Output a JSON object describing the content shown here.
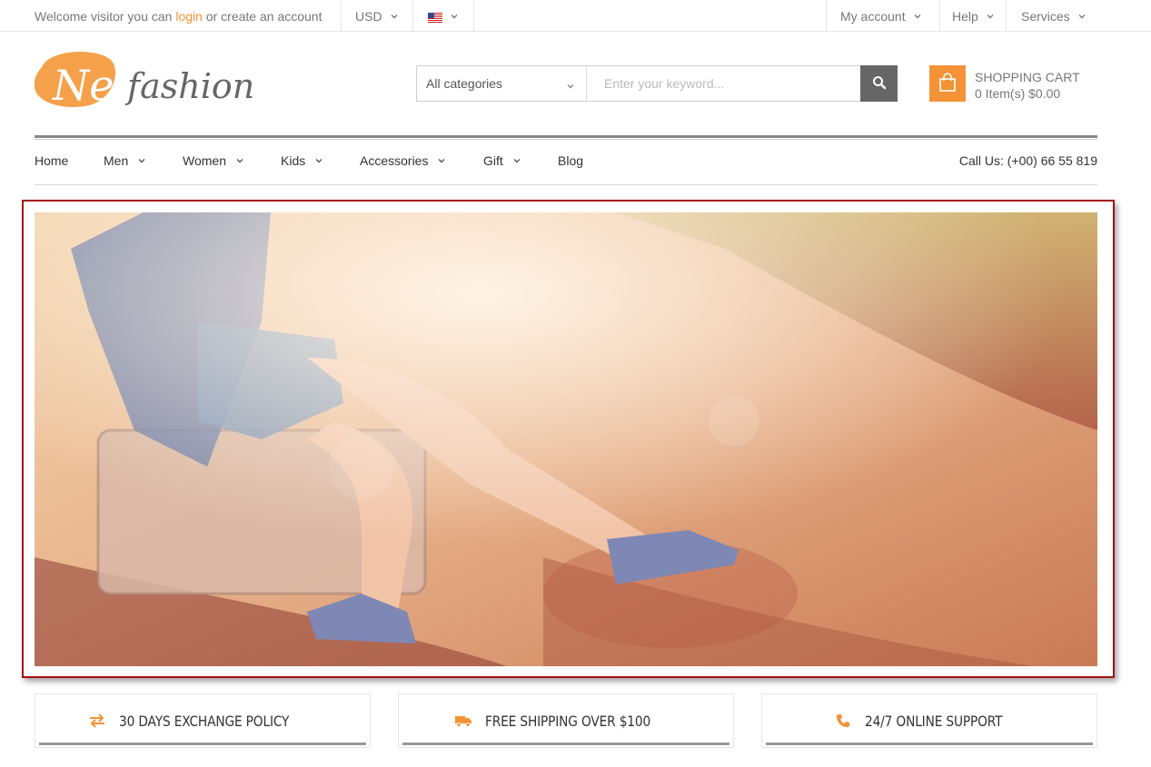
{
  "topbar": {
    "welcome_prefix": "Welcome visitor you can",
    "login_link": "login",
    "welcome_suffix": "or create an account",
    "currency": "USD",
    "language_flag": "us-flag-icon",
    "my_account": "My account",
    "help": "Help",
    "services": "Services"
  },
  "header": {
    "logo_text_script": "Nella",
    "logo_text_tail": "fashion",
    "search_category": "All categories",
    "search_placeholder": "Enter your keyword...",
    "search_icon": "search-icon",
    "cart_icon": "shopping-bag-icon",
    "cart_title": "SHOPPING CART",
    "cart_summary": "0 Item(s) $0.00"
  },
  "nav": {
    "items": [
      {
        "label": "Home",
        "dropdown": false
      },
      {
        "label": "Men",
        "dropdown": true
      },
      {
        "label": "Women",
        "dropdown": true
      },
      {
        "label": "Kids",
        "dropdown": true
      },
      {
        "label": "Accessories",
        "dropdown": true
      },
      {
        "label": "Gift",
        "dropdown": true
      },
      {
        "label": "Blog",
        "dropdown": false
      }
    ],
    "call_us": "Call Us: (+00) 66 55 819"
  },
  "features": [
    {
      "icon": "exchange-arrows-icon",
      "label": "30 DAYS EXCHANGE POLICY"
    },
    {
      "icon": "truck-icon",
      "label": "FREE SHIPPING OVER $100"
    },
    {
      "icon": "phone-icon",
      "label": "24/7 ONLINE SUPPORT"
    }
  ],
  "colors": {
    "accent": "#f39237",
    "banner_border": "#a50f15",
    "text": "#333333",
    "muted": "#777777"
  }
}
